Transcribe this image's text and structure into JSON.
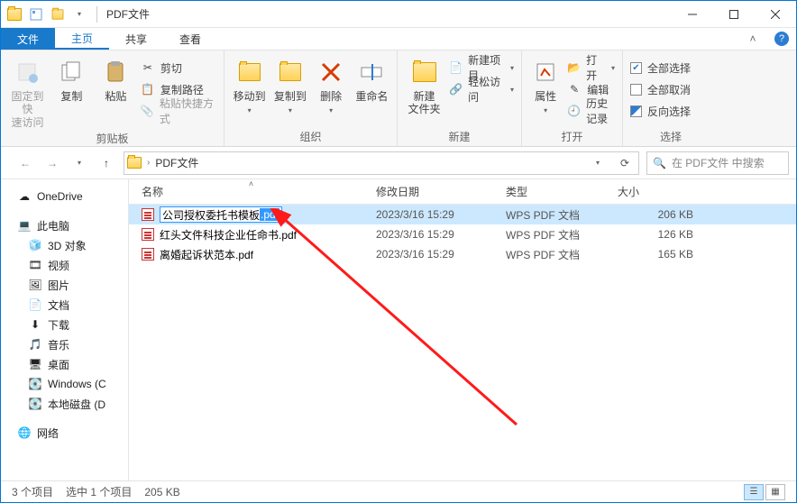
{
  "window": {
    "title": "PDF文件"
  },
  "ribbon_tabs": {
    "file": "文件",
    "home": "主页",
    "share": "共享",
    "view": "查看"
  },
  "ribbon": {
    "pin": "固定到快\n速访问",
    "copy": "复制",
    "paste": "粘贴",
    "cut": "剪切",
    "copy_path": "复制路径",
    "paste_shortcut": "粘贴快捷方式",
    "clipboard": "剪贴板",
    "move_to": "移动到",
    "copy_to": "复制到",
    "delete": "删除",
    "rename": "重命名",
    "organize": "组织",
    "new_folder": "新建\n文件夹",
    "new_item": "新建项目",
    "easy_access": "轻松访问",
    "new": "新建",
    "properties": "属性",
    "open": "打开",
    "edit": "编辑",
    "history": "历史记录",
    "open_group": "打开",
    "select_all": "全部选择",
    "select_none": "全部取消",
    "invert": "反向选择",
    "select": "选择"
  },
  "nav": {
    "folder": "PDF文件",
    "search_placeholder": "在 PDF文件 中搜索"
  },
  "columns": {
    "name": "名称",
    "date": "修改日期",
    "type": "类型",
    "size": "大小"
  },
  "tree": {
    "onedrive": "OneDrive",
    "this_pc": "此电脑",
    "objects3d": "3D 对象",
    "videos": "视频",
    "pictures": "图片",
    "documents": "文档",
    "downloads": "下载",
    "music": "音乐",
    "desktop": "桌面",
    "windows_c": "Windows (C",
    "local_d": "本地磁盘 (D",
    "network": "网络"
  },
  "files": [
    {
      "name_base": "公司授权委托书模板",
      "name_ext": ".pdf",
      "date": "2023/3/16 15:29",
      "type": "WPS PDF 文档",
      "size": "206 KB",
      "selected": true,
      "renaming": true
    },
    {
      "name": "红头文件科技企业任命书.pdf",
      "date": "2023/3/16 15:29",
      "type": "WPS PDF 文档",
      "size": "126 KB"
    },
    {
      "name": "离婚起诉状范本.pdf",
      "date": "2023/3/16 15:29",
      "type": "WPS PDF 文档",
      "size": "165 KB"
    }
  ],
  "status": {
    "count": "3 个项目",
    "selected": "选中 1 个项目",
    "size": "205 KB"
  }
}
